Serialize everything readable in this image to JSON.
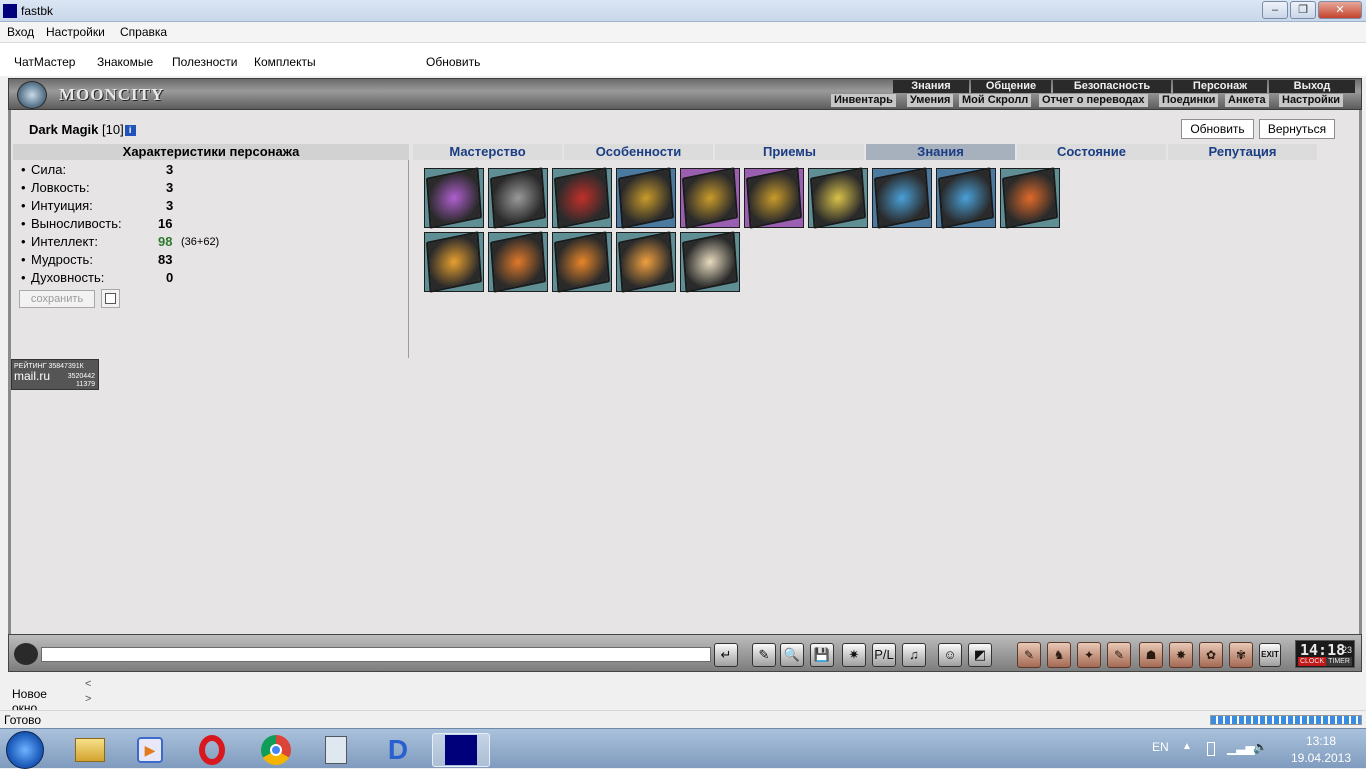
{
  "window": {
    "title": "fastbk"
  },
  "menubar": {
    "items": [
      "Вход",
      "Настройки",
      "Справка"
    ]
  },
  "toolbar": {
    "items": [
      "ЧатМастер",
      "Знакомые",
      "Полезности",
      "Комплекты"
    ],
    "refresh": "Обновить"
  },
  "game": {
    "logo": "MOONCITY",
    "nav_top": [
      "Знания",
      "Общение",
      "Безопасность",
      "Персонаж",
      "Выход"
    ],
    "nav_sub": [
      "Инвентарь",
      "Умения",
      "Мой Скролл",
      "Отчет о переводах",
      "Поединки",
      "Анкета",
      "Настройки"
    ]
  },
  "character": {
    "name": "Dark Magik",
    "level": "[10]",
    "info_icon": "i",
    "refresh_button": "Обновить",
    "back_button": "Вернуться"
  },
  "stats": {
    "header": "Характеристики персонажа",
    "rows": [
      {
        "label": "Сила:",
        "value": "3",
        "bonus": ""
      },
      {
        "label": "Ловкость:",
        "value": "3",
        "bonus": ""
      },
      {
        "label": "Интуиция:",
        "value": "3",
        "bonus": ""
      },
      {
        "label": "Выносливость:",
        "value": "16",
        "bonus": ""
      },
      {
        "label": "Интеллект:",
        "value": "98",
        "bonus": "(36+62)",
        "value_color": "#2d7a2d"
      },
      {
        "label": "Мудрость:",
        "value": "83",
        "bonus": ""
      },
      {
        "label": "Духовность:",
        "value": "0",
        "bonus": ""
      }
    ],
    "save_button": "сохранить",
    "bullet": "•"
  },
  "tabs": {
    "items": [
      "Мастерство",
      "Особенности",
      "Приемы",
      "Знания",
      "Состояние",
      "Репутация"
    ],
    "active": "Знания"
  },
  "scrolls": [
    {
      "color": "#b05fd0"
    },
    {
      "color": "#9a9a9a"
    },
    {
      "color": "#c2302a"
    },
    {
      "color": "#c99b2a"
    },
    {
      "color": "#c99b2a"
    },
    {
      "color": "#c99b2a"
    },
    {
      "color": "#d9c24a"
    },
    {
      "color": "#4aa0d8"
    },
    {
      "color": "#4aa0d8"
    },
    {
      "color": "#e06a2a"
    },
    {
      "color": "#e8a030"
    },
    {
      "color": "#e07a2a"
    },
    {
      "color": "#e8862a"
    },
    {
      "color": "#f0a040"
    },
    {
      "color": "#e8dcc0"
    }
  ],
  "scroll_bg": [
    "#5f8f94",
    "#5f8f94",
    "#5f8f94",
    "#4a7aa0",
    "#9a5fb0",
    "#9a5fb0",
    "#5f8f94",
    "#4a7aa0",
    "#4a7aa0",
    "#5f8f94",
    "#5f8f94",
    "#5f8f94",
    "#5f8f94",
    "#5f8f94",
    "#5f8f94"
  ],
  "rating": {
    "label": "РЕЙТИНГ",
    "line1": "35847391К",
    "brand": "mail.ru",
    "line2": "3520442",
    "line3": "11379"
  },
  "chatbar": {
    "icons": [
      "↵",
      "✎",
      "🔍",
      "💾",
      "✷",
      "P/L",
      "♫",
      "☺",
      "◩"
    ],
    "icons2": [
      "✎",
      "♞",
      "✦",
      "✎",
      "☗",
      "✸",
      "✿",
      "✾"
    ],
    "exit_label": "EXIT",
    "clock": {
      "time": "14:18",
      "seconds": "23",
      "clock_label": "CLOCK",
      "timer_label": "TIMER"
    }
  },
  "subtab": {
    "label": "Новое окно",
    "arrow_left": "<",
    "arrow_right": ">"
  },
  "status": {
    "text": "Готово"
  },
  "taskbar": {
    "lang": "EN",
    "time": "13:18",
    "date": "19.04.2013"
  }
}
